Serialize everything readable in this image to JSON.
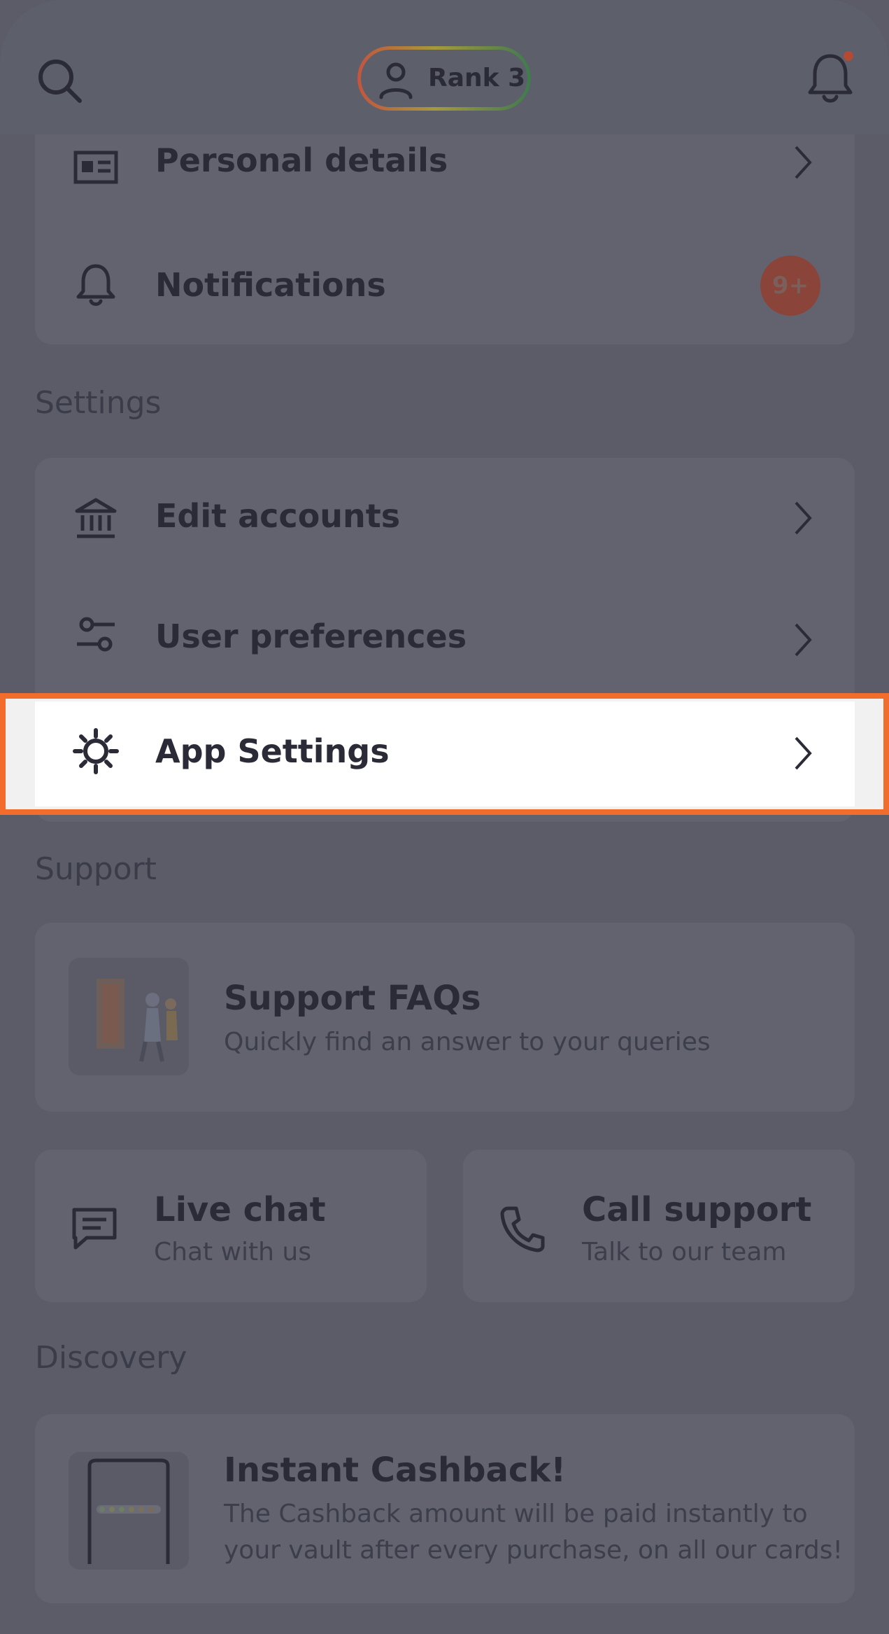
{
  "header": {
    "rank_label": "Rank 3",
    "icons": [
      "search-icon",
      "person-icon",
      "bell-icon"
    ]
  },
  "account_rows": [
    {
      "label": "Personal details",
      "icon": "id-card-icon"
    },
    {
      "label": "Notifications",
      "icon": "bell-icon",
      "badge": "9+"
    }
  ],
  "settings": {
    "section_title": "Settings",
    "rows": [
      {
        "label": "Edit accounts",
        "icon": "bank-icon"
      },
      {
        "label": "User preferences",
        "icon": "sliders-icon"
      },
      {
        "label": "App Settings",
        "icon": "gear-icon"
      }
    ]
  },
  "support": {
    "section_title": "Support",
    "faq": {
      "title": "Support FAQs",
      "subtitle": "Quickly find an answer to your queries"
    },
    "live_chat": {
      "title": "Live chat",
      "subtitle": "Chat with us"
    },
    "call_support": {
      "title": "Call support",
      "subtitle": "Talk to our team"
    }
  },
  "discovery": {
    "section_title": "Discovery",
    "promo": {
      "title": "Instant Cashback!",
      "line1": "The Cashback amount will be paid instantly to",
      "line2": "your vault after every purchase, on all our cards!"
    }
  },
  "colors": {
    "overlay": "#5b5c68",
    "highlight_border": "#f26c2b",
    "badge": "#8a4439"
  }
}
